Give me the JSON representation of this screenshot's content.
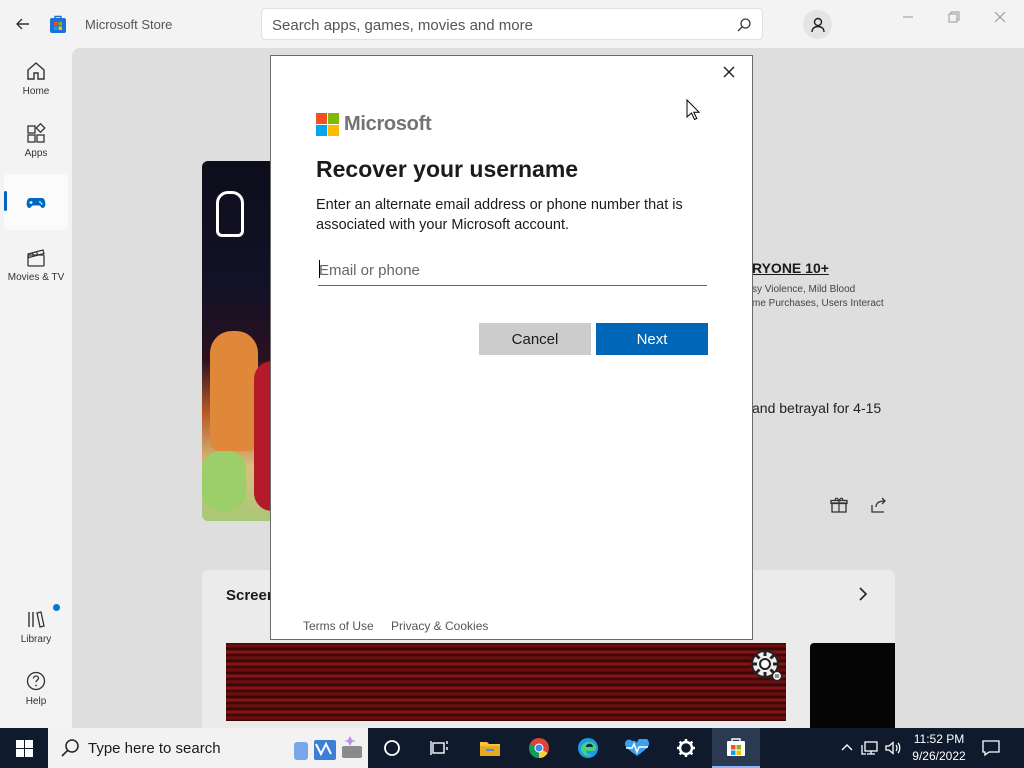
{
  "window": {
    "title": "Microsoft Store",
    "search_placeholder": "Search apps, games, movies and more"
  },
  "sidebar": {
    "items": [
      {
        "label": "Home",
        "icon": "home-icon"
      },
      {
        "label": "Apps",
        "icon": "apps-icon"
      },
      {
        "label": "",
        "icon": "gaming-icon",
        "active": true
      },
      {
        "label": "Movies & TV",
        "icon": "movies-icon"
      },
      {
        "label": "Library",
        "icon": "library-icon"
      },
      {
        "label": "Help",
        "icon": "help-icon"
      }
    ]
  },
  "store_page": {
    "rating": "RYONE 10+",
    "rating_desc_1": "sy Violence, Mild Blood",
    "rating_desc_2": "me Purchases, Users Interact",
    "description": "and betrayal for 4-15",
    "screenshots_title": "Screen"
  },
  "dialog": {
    "brand": "Microsoft",
    "title": "Recover your username",
    "body": "Enter an alternate email address or phone number that is associated with your Microsoft account.",
    "input_placeholder": "Email or phone",
    "input_value": "",
    "cancel_label": "Cancel",
    "next_label": "Next",
    "terms_label": "Terms of Use",
    "privacy_label": "Privacy & Cookies"
  },
  "taskbar": {
    "search_text": "Type here to search",
    "apps": [
      "cortana-icon",
      "task-view-icon",
      "file-explorer-icon",
      "chrome-icon",
      "edge-icon",
      "health-icon",
      "settings-icon",
      "store-icon"
    ],
    "time": "11:52 PM",
    "date": "9/26/2022"
  },
  "colors": {
    "accent": "#0067b8",
    "ms_red": "#f25022",
    "ms_green": "#7fba00",
    "ms_blue": "#00a4ef",
    "ms_yellow": "#ffb900",
    "taskbar": "#0f1b2d"
  }
}
